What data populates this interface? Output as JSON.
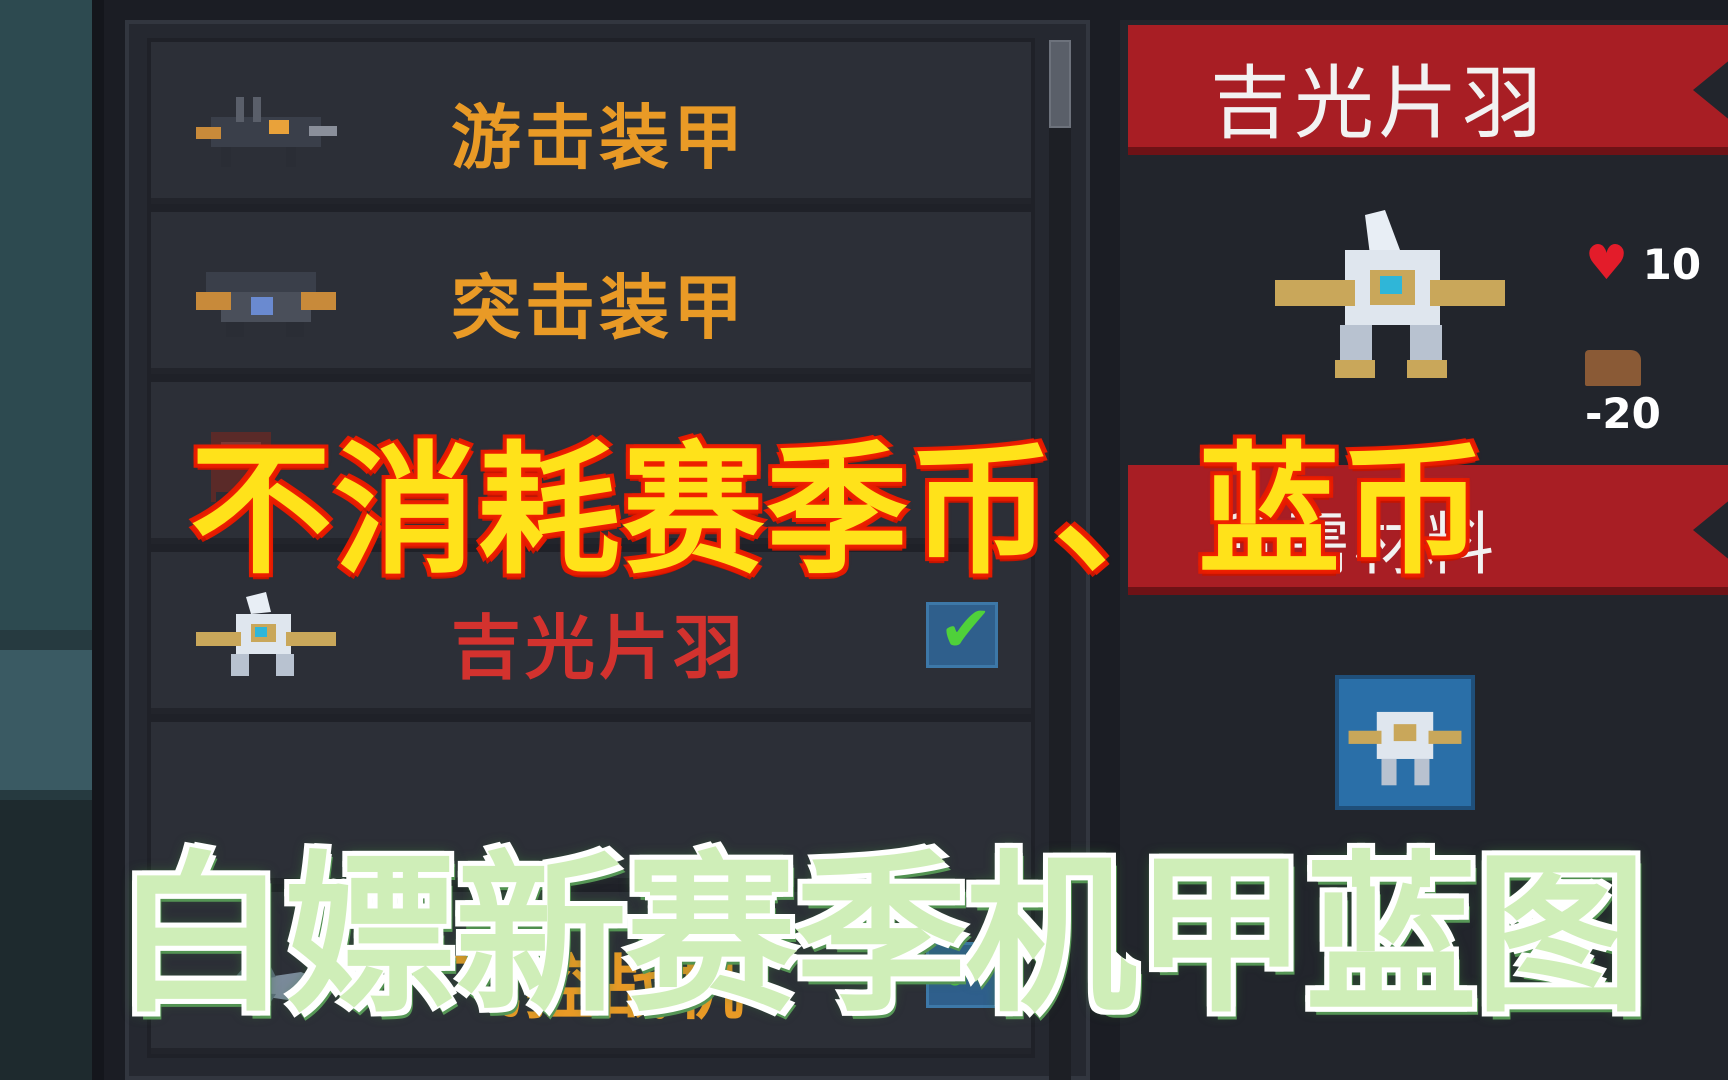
{
  "mech_list": {
    "items": [
      {
        "name": "游击装甲",
        "color": "#e99a26",
        "selected": false,
        "owned": false
      },
      {
        "name": "突击装甲",
        "color": "#e99a26",
        "selected": false,
        "owned": false
      },
      {
        "name": "",
        "color": "#e99a26",
        "selected": false,
        "owned": false
      },
      {
        "name": "吉光片羽",
        "color": "#d3322e",
        "selected": true,
        "owned": true
      },
      {
        "name": "",
        "color": "#e99a26",
        "selected": false,
        "owned": false
      },
      {
        "name": "飞控战机",
        "color": "#e99a26",
        "selected": false,
        "owned": true
      }
    ]
  },
  "detail": {
    "title": "吉光片羽",
    "stats": {
      "health": "10",
      "speed": "-20"
    },
    "section2_title": "所需材料",
    "icons": [
      "heart-icon",
      "boot-icon",
      "blueprint-icon"
    ]
  },
  "captions": {
    "top": "不消耗赛季币、蓝币",
    "bottom": "白嫖新赛季机甲蓝图"
  }
}
